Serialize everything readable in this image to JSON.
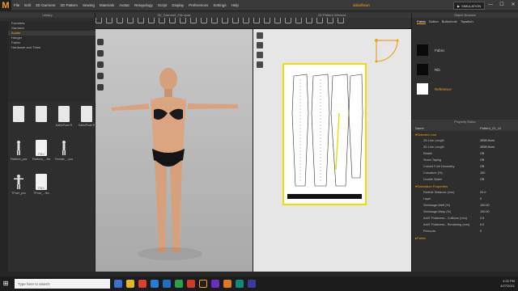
{
  "menubar": {
    "logo": "M",
    "items": [
      "File",
      "Edit",
      "3D Garment",
      "2D Pattern",
      "Sewing",
      "Materials",
      "Avatar",
      "Retopology",
      "Script",
      "Display",
      "Preferences",
      "Settings",
      "Help"
    ],
    "user": "dddallstart",
    "sim_button": "SIMULATION",
    "window_controls": [
      "—",
      "☐",
      "✕"
    ]
  },
  "library": {
    "title": "Library",
    "tree": [
      "Favorites",
      "Garment",
      "Avatar",
      "Hanger",
      "Fabric",
      "Hardware and Trims"
    ],
    "active_index": 2,
    "files": [
      {
        "label": "",
        "type": "folder"
      },
      {
        "label": "",
        "type": "folder"
      },
      {
        "label": "KabloPose R",
        "type": "folder"
      },
      {
        "label": "KabloPose R",
        "type": "folder"
      },
      {
        "label": "Platform_pos",
        "type": "avatar"
      },
      {
        "label": "Platform_...fbx",
        "type": "fbx"
      },
      {
        "label": "Female_...pos",
        "type": "avatar"
      },
      {
        "label": "",
        "type": "empty"
      },
      {
        "label": "TPose_pos",
        "type": "avatar"
      },
      {
        "label": "TPose_...fbx",
        "type": "fbx"
      }
    ]
  },
  "view3d": {
    "title": "3D_Garment_File.zpac"
  },
  "view2d": {
    "title": "2D Pattern Window"
  },
  "object_browser": {
    "title": "Object Browser",
    "tabs": [
      "Fabric",
      "Button",
      "Buttonhole",
      "Topstitch"
    ],
    "items": [
      {
        "name": "Fabric",
        "color": "#0a0a0a"
      },
      {
        "name": "Rib",
        "color": "#0a0a0a"
      },
      {
        "name": "Reference",
        "color": "#ffffff"
      }
    ],
    "selected_index": 2
  },
  "property_editor": {
    "title": "Property Editor",
    "name_label": "Name",
    "name_value": "Pattern_01_12",
    "sections": [
      {
        "heading": "Selected Line",
        "rows": [
          {
            "label": "2D Line Length",
            "value": "3958.9mm"
          },
          {
            "label": "3D Line Length",
            "value": "3958.9mm"
          },
          {
            "label": "Elastic",
            "value": "Off"
          },
          {
            "label": "Seam Taping",
            "value": "Off"
          },
          {
            "label": "Curved Fold Geometry",
            "value": "Off"
          },
          {
            "label": "Curvature (%)",
            "value": "100"
          },
          {
            "label": "Double Sided",
            "value": "Off"
          }
        ]
      },
      {
        "heading": "Simulation Properties",
        "rows": [
          {
            "label": "Particle Distance (mm)",
            "value": "20.0"
          },
          {
            "label": "Layer",
            "value": "0"
          },
          {
            "label": "Shrinkage-Weft (%)",
            "value": "100.00"
          },
          {
            "label": "Shrinkage-Warp (%)",
            "value": "100.00"
          },
          {
            "label": "Add'l Thickness - Collision (mm)",
            "value": "2.5"
          },
          {
            "label": "Add'l Thickness - Rendering (mm)",
            "value": "0.0"
          },
          {
            "label": "Pressure",
            "value": "0"
          }
        ]
      },
      {
        "heading": "Fabric",
        "rows": []
      }
    ]
  },
  "taskbar": {
    "search_placeholder": "Type here to search",
    "time": "4:32 PM",
    "date": "4/27/2021"
  },
  "colors": {
    "accent": "#f0a020",
    "pattern_border": "#e8e000",
    "panel_bg": "#2e2e2e",
    "viewport_bg": "#c9c9c9"
  }
}
